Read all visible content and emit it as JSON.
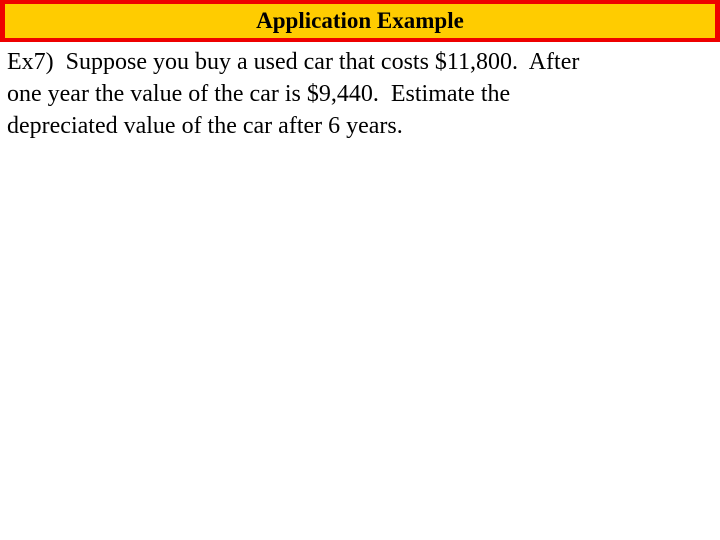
{
  "slide": {
    "background_color": "#ffffff",
    "title_bar": {
      "text": "Application Example",
      "fill_color": "#ffcc00",
      "border_color": "#ee0000"
    },
    "body": {
      "text_color": "#000000",
      "lines": [
        "Ex7)  Suppose you buy a used car that costs $11,800.  After",
        "one year the value of the car is $9,440.  Estimate the",
        "depreciated value of the car after 6 years."
      ],
      "full_text": "Ex7)  Suppose you buy a used car that costs $11,800.  After one year the value of the car is $9,440.  Estimate the depreciated value of the car after 6 years.",
      "values": {
        "example_number": "Ex7)",
        "initial_cost": "$11,800",
        "value_after_one_year": "$9,440",
        "years_to_estimate": "6 years"
      }
    }
  }
}
